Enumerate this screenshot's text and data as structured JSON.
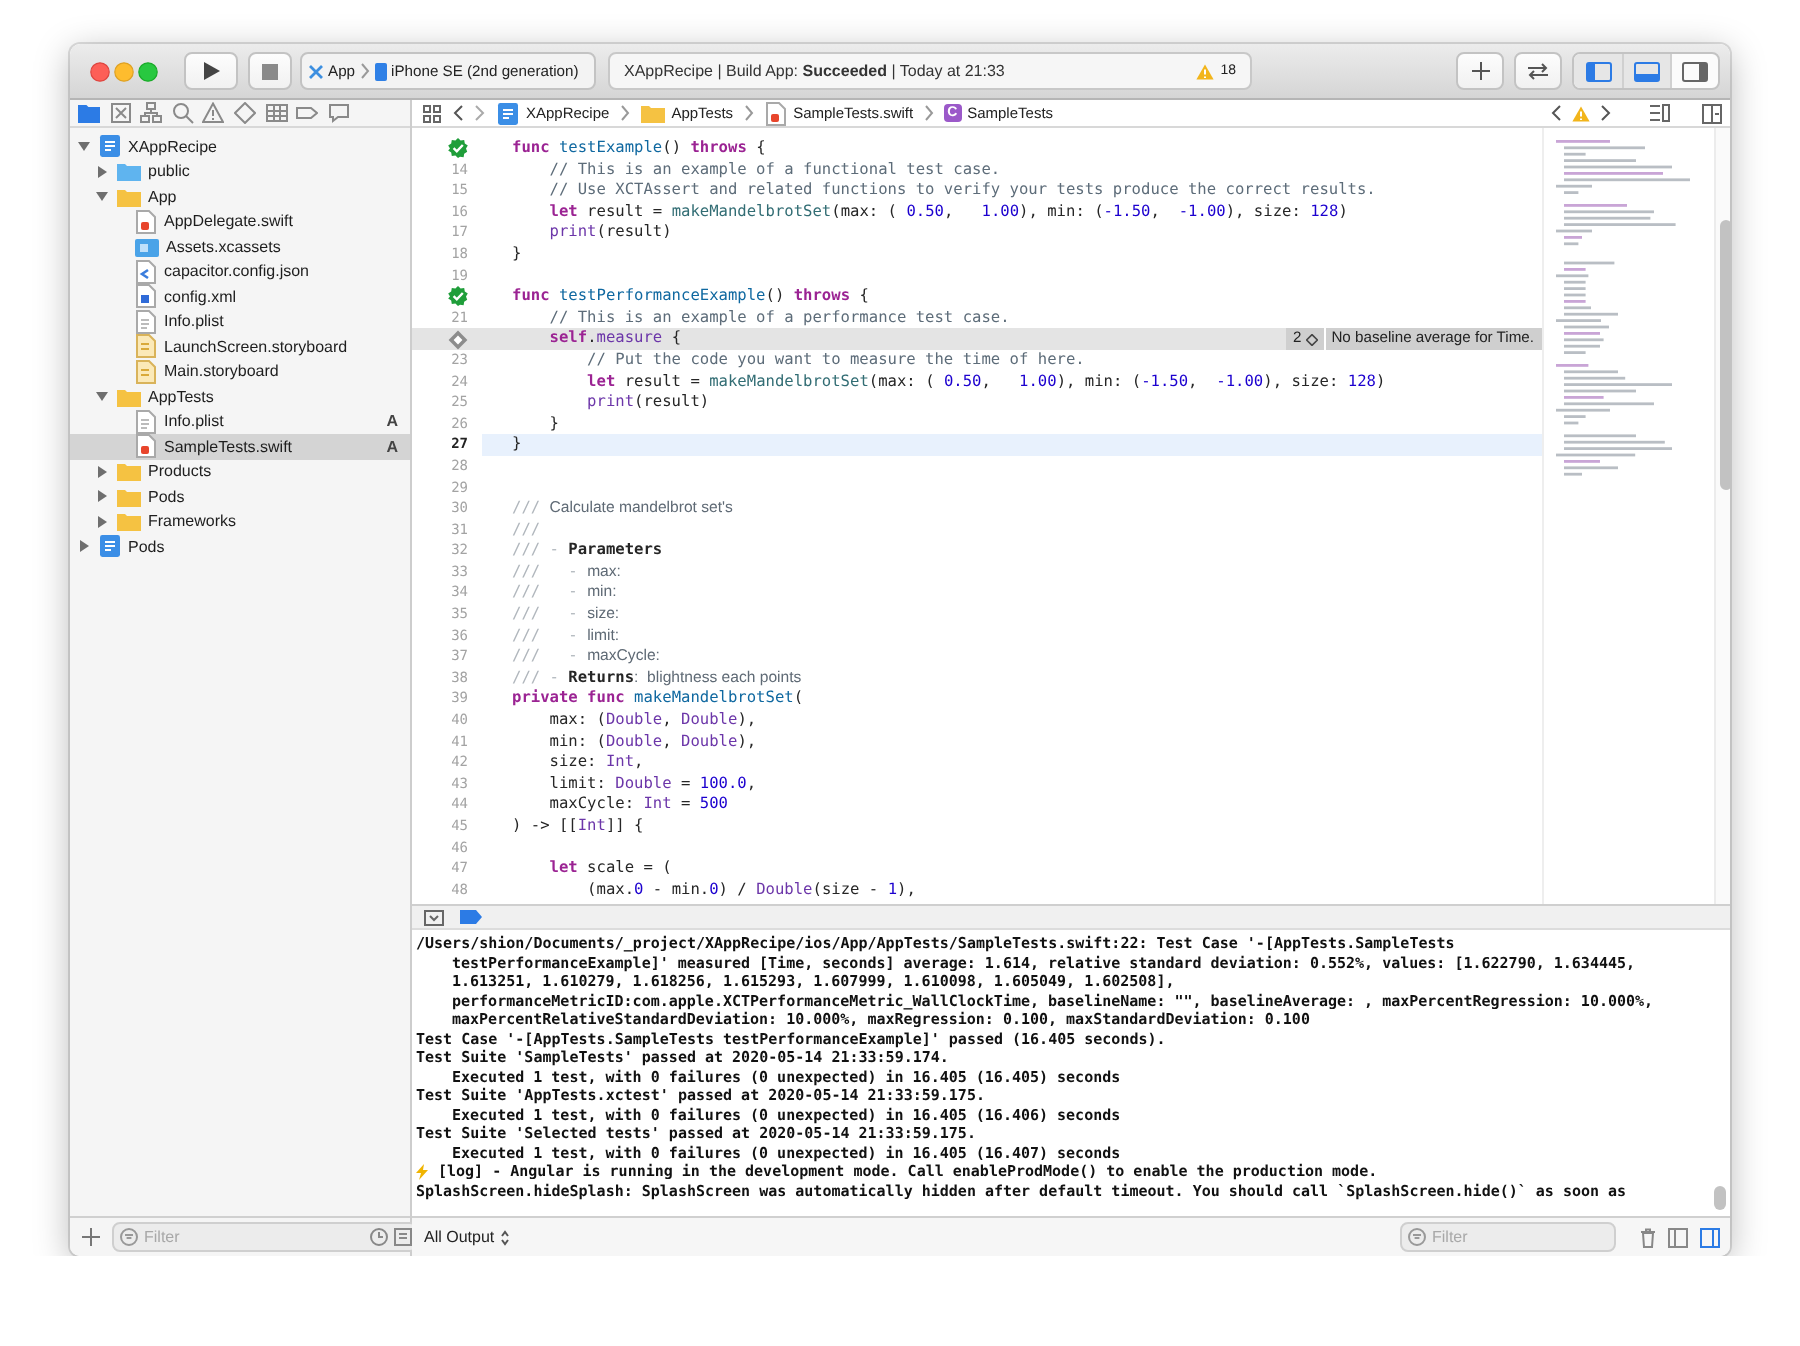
{
  "toolbar": {
    "scheme": {
      "target": "App",
      "device": "iPhone SE (2nd generation)"
    },
    "status": {
      "text": "XAppRecipe | Build App: **Succeeded** | Today at 21:33",
      "warnings": "18"
    },
    "panel_toggles": [
      {
        "kind": "navigator",
        "selected": true
      },
      {
        "kind": "debug",
        "selected": true
      },
      {
        "kind": "inspector",
        "selected": false
      }
    ]
  },
  "navigator": {
    "tabs": [
      {
        "kind": "project",
        "selected": true
      },
      {
        "kind": "source_control",
        "selected": false
      },
      {
        "kind": "symbols",
        "selected": false
      },
      {
        "kind": "find",
        "selected": false
      },
      {
        "kind": "issues",
        "selected": false
      },
      {
        "kind": "tests",
        "selected": false
      },
      {
        "kind": "debug",
        "selected": false
      },
      {
        "kind": "breakpoints",
        "selected": false
      },
      {
        "kind": "reports",
        "selected": false
      }
    ],
    "tree": [
      {
        "label": "XAppRecipe",
        "kind": "project",
        "expanded": true,
        "selected": false,
        "children": [
          {
            "label": "public",
            "kind": "folder_reference",
            "expanded": false,
            "selected": false
          },
          {
            "label": "App",
            "kind": "group",
            "expanded": true,
            "selected": false,
            "children": [
              {
                "label": "AppDelegate.swift",
                "kind": "swift",
                "selected": false
              },
              {
                "label": "Assets.xcassets",
                "kind": "assets",
                "selected": false
              },
              {
                "label": "capacitor.config.json",
                "kind": "json",
                "selected": false
              },
              {
                "label": "config.xml",
                "kind": "xml",
                "selected": false
              },
              {
                "label": "Info.plist",
                "kind": "plist",
                "selected": false
              },
              {
                "label": "LaunchScreen.storyboard",
                "kind": "storyboard",
                "selected": false
              },
              {
                "label": "Main.storyboard",
                "kind": "storyboard",
                "selected": false
              }
            ]
          },
          {
            "label": "AppTests",
            "kind": "group",
            "expanded": true,
            "selected": false,
            "children": [
              {
                "label": "Info.plist",
                "kind": "plist",
                "status": "A",
                "selected": false
              },
              {
                "label": "SampleTests.swift",
                "kind": "swift",
                "status": "A",
                "selected": true
              }
            ]
          },
          {
            "label": "Products",
            "kind": "group",
            "expanded": false,
            "selected": false
          },
          {
            "label": "Pods",
            "kind": "group",
            "expanded": false,
            "selected": false
          },
          {
            "label": "Frameworks",
            "kind": "group",
            "expanded": false,
            "selected": false
          }
        ]
      },
      {
        "label": "Pods",
        "kind": "project",
        "expanded": false,
        "selected": false
      }
    ],
    "filter": {
      "placeholder": "Filter"
    }
  },
  "jump_bar": {
    "crumbs": [
      {
        "kind": "project",
        "label": "XAppRecipe"
      },
      {
        "kind": "folder",
        "label": "AppTests"
      },
      {
        "kind": "swift",
        "label": "SampleTests.swift"
      },
      {
        "kind": "class",
        "badge": "C",
        "label": "SampleTests"
      }
    ]
  },
  "editor": {
    "lines": [
      {
        "kind": "test_passed",
        "current": false,
        "tokens": [
          {
            "kind": "kw",
            "text": "func"
          },
          {
            "kind": "decl",
            "text": " testExample"
          },
          {
            "kind": "plain",
            "text": "() "
          },
          {
            "kind": "kw",
            "text": "throws"
          },
          {
            "kind": "plain",
            "text": " {"
          }
        ]
      },
      {
        "kind": "code",
        "number": "14",
        "current": false,
        "tokens": [
          {
            "kind": "comment",
            "text": "    // This is an example of a functional test case."
          }
        ]
      },
      {
        "kind": "code",
        "number": "15",
        "current": false,
        "tokens": [
          {
            "kind": "comment",
            "text": "    // Use XCTAssert and related functions to verify your tests produce the correct results."
          }
        ]
      },
      {
        "kind": "code",
        "number": "16",
        "current": false,
        "tokens": [
          {
            "kind": "kw",
            "text": "    let"
          },
          {
            "kind": "plain",
            "text": " result = "
          },
          {
            "kind": "fn",
            "text": "makeMandelbrotSet"
          },
          {
            "kind": "plain",
            "text": "(max: ( "
          },
          {
            "kind": "num",
            "text": "0.50"
          },
          {
            "kind": "plain",
            "text": ",   "
          },
          {
            "kind": "num",
            "text": "1.00"
          },
          {
            "kind": "plain",
            "text": "), min: ("
          },
          {
            "kind": "num",
            "text": "-1.50"
          },
          {
            "kind": "plain",
            "text": ",  "
          },
          {
            "kind": "num",
            "text": "-1.00"
          },
          {
            "kind": "plain",
            "text": "), size: "
          },
          {
            "kind": "num",
            "text": "128"
          },
          {
            "kind": "plain",
            "text": ")"
          }
        ]
      },
      {
        "kind": "code",
        "number": "17",
        "current": false,
        "tokens": [
          {
            "kind": "sys",
            "text": "    print"
          },
          {
            "kind": "plain",
            "text": "(result)"
          }
        ]
      },
      {
        "kind": "code",
        "number": "18",
        "current": false,
        "tokens": [
          {
            "kind": "plain",
            "text": "}"
          }
        ]
      },
      {
        "kind": "code",
        "number": "19",
        "current": false
      },
      {
        "kind": "test_passed",
        "current": false,
        "tokens": [
          {
            "kind": "kw",
            "text": "func"
          },
          {
            "kind": "decl",
            "text": " testPerformanceExample"
          },
          {
            "kind": "plain",
            "text": "() "
          },
          {
            "kind": "kw",
            "text": "throws"
          },
          {
            "kind": "plain",
            "text": " {"
          }
        ]
      },
      {
        "kind": "code",
        "number": "21",
        "current": false,
        "tokens": [
          {
            "kind": "comment",
            "text": "    // This is an example of a performance test case."
          }
        ]
      },
      {
        "kind": "test_diamond",
        "current": false,
        "annotation": {
          "count": "2",
          "text": "No baseline average for Time."
        },
        "tokens": [
          {
            "kind": "kw",
            "text": "    self"
          },
          {
            "kind": "plain",
            "text": "."
          },
          {
            "kind": "sys",
            "text": "measure"
          },
          {
            "kind": "plain",
            "text": " {"
          }
        ]
      },
      {
        "kind": "code",
        "number": "23",
        "current": false,
        "tokens": [
          {
            "kind": "comment",
            "text": "        // Put the code you want to measure the time of here."
          }
        ]
      },
      {
        "kind": "code",
        "number": "24",
        "current": false,
        "tokens": [
          {
            "kind": "kw",
            "text": "        let"
          },
          {
            "kind": "plain",
            "text": " result = "
          },
          {
            "kind": "fn",
            "text": "makeMandelbrotSet"
          },
          {
            "kind": "plain",
            "text": "(max: ( "
          },
          {
            "kind": "num",
            "text": "0.50"
          },
          {
            "kind": "plain",
            "text": ",   "
          },
          {
            "kind": "num",
            "text": "1.00"
          },
          {
            "kind": "plain",
            "text": "), min: ("
          },
          {
            "kind": "num",
            "text": "-1.50"
          },
          {
            "kind": "plain",
            "text": ",  "
          },
          {
            "kind": "num",
            "text": "-1.00"
          },
          {
            "kind": "plain",
            "text": "), size: "
          },
          {
            "kind": "num",
            "text": "128"
          },
          {
            "kind": "plain",
            "text": ")"
          }
        ]
      },
      {
        "kind": "code",
        "number": "25",
        "current": false,
        "tokens": [
          {
            "kind": "sys",
            "text": "        print"
          },
          {
            "kind": "plain",
            "text": "(result)"
          }
        ]
      },
      {
        "kind": "code",
        "number": "26",
        "current": false,
        "tokens": [
          {
            "kind": "plain",
            "text": "    }"
          }
        ]
      },
      {
        "kind": "code",
        "number": "27",
        "current": true,
        "tokens": [
          {
            "kind": "plain",
            "text": "}"
          }
        ]
      },
      {
        "kind": "code",
        "number": "28",
        "current": false
      },
      {
        "kind": "code",
        "number": "29",
        "current": false
      },
      {
        "kind": "code",
        "number": "30",
        "current": false,
        "tokens": [
          {
            "kind": "docmark",
            "text": "/// "
          },
          {
            "kind": "doc",
            "text": "Calculate mandelbrot set's"
          }
        ]
      },
      {
        "kind": "code",
        "number": "31",
        "current": false,
        "tokens": [
          {
            "kind": "docmark",
            "text": "///"
          }
        ]
      },
      {
        "kind": "code",
        "number": "32",
        "current": false,
        "tokens": [
          {
            "kind": "docmark",
            "text": "/// - "
          },
          {
            "kind": "docbold",
            "text": "Parameters"
          }
        ]
      },
      {
        "kind": "code",
        "number": "33",
        "current": false,
        "tokens": [
          {
            "kind": "docmark",
            "text": "///   - "
          },
          {
            "kind": "doc",
            "text": "max:"
          }
        ]
      },
      {
        "kind": "code",
        "number": "34",
        "current": false,
        "tokens": [
          {
            "kind": "docmark",
            "text": "///   - "
          },
          {
            "kind": "doc",
            "text": "min:"
          }
        ]
      },
      {
        "kind": "code",
        "number": "35",
        "current": false,
        "tokens": [
          {
            "kind": "docmark",
            "text": "///   - "
          },
          {
            "kind": "doc",
            "text": "size:"
          }
        ]
      },
      {
        "kind": "code",
        "number": "36",
        "current": false,
        "tokens": [
          {
            "kind": "docmark",
            "text": "///   - "
          },
          {
            "kind": "doc",
            "text": "limit:"
          }
        ]
      },
      {
        "kind": "code",
        "number": "37",
        "current": false,
        "tokens": [
          {
            "kind": "docmark",
            "text": "///   - "
          },
          {
            "kind": "doc",
            "text": "maxCycle:"
          }
        ]
      },
      {
        "kind": "code",
        "number": "38",
        "current": false,
        "tokens": [
          {
            "kind": "docmark",
            "text": "/// - "
          },
          {
            "kind": "docbold",
            "text": "Returns"
          },
          {
            "kind": "doc",
            "text": ":  blightness each points"
          }
        ]
      },
      {
        "kind": "code",
        "number": "39",
        "current": false,
        "tokens": [
          {
            "kind": "kw",
            "text": "private func"
          },
          {
            "kind": "decl",
            "text": " makeMandelbrotSet"
          },
          {
            "kind": "plain",
            "text": "("
          }
        ]
      },
      {
        "kind": "code",
        "number": "40",
        "current": false,
        "tokens": [
          {
            "kind": "plain",
            "text": "    max: ("
          },
          {
            "kind": "type",
            "text": "Double"
          },
          {
            "kind": "plain",
            "text": ", "
          },
          {
            "kind": "type",
            "text": "Double"
          },
          {
            "kind": "plain",
            "text": "),"
          }
        ]
      },
      {
        "kind": "code",
        "number": "41",
        "current": false,
        "tokens": [
          {
            "kind": "plain",
            "text": "    min: ("
          },
          {
            "kind": "type",
            "text": "Double"
          },
          {
            "kind": "plain",
            "text": ", "
          },
          {
            "kind": "type",
            "text": "Double"
          },
          {
            "kind": "plain",
            "text": "),"
          }
        ]
      },
      {
        "kind": "code",
        "number": "42",
        "current": false,
        "tokens": [
          {
            "kind": "plain",
            "text": "    size: "
          },
          {
            "kind": "type",
            "text": "Int"
          },
          {
            "kind": "plain",
            "text": ","
          }
        ]
      },
      {
        "kind": "code",
        "number": "43",
        "current": false,
        "tokens": [
          {
            "kind": "plain",
            "text": "    limit: "
          },
          {
            "kind": "type",
            "text": "Double"
          },
          {
            "kind": "plain",
            "text": " = "
          },
          {
            "kind": "num",
            "text": "100.0"
          },
          {
            "kind": "plain",
            "text": ","
          }
        ]
      },
      {
        "kind": "code",
        "number": "44",
        "current": false,
        "tokens": [
          {
            "kind": "plain",
            "text": "    maxCycle: "
          },
          {
            "kind": "type",
            "text": "Int"
          },
          {
            "kind": "plain",
            "text": " = "
          },
          {
            "kind": "num",
            "text": "500"
          }
        ]
      },
      {
        "kind": "code",
        "number": "45",
        "current": false,
        "tokens": [
          {
            "kind": "plain",
            "text": ") -> [["
          },
          {
            "kind": "type",
            "text": "Int"
          },
          {
            "kind": "plain",
            "text": "]] {"
          }
        ]
      },
      {
        "kind": "code",
        "number": "46",
        "current": false
      },
      {
        "kind": "code",
        "number": "47",
        "current": false,
        "tokens": [
          {
            "kind": "kw",
            "text": "    let"
          },
          {
            "kind": "plain",
            "text": " scale = ("
          }
        ]
      },
      {
        "kind": "code",
        "number": "48",
        "current": false,
        "tokens": [
          {
            "kind": "plain",
            "text": "        (max."
          },
          {
            "kind": "num",
            "text": "0"
          },
          {
            "kind": "plain",
            "text": " - min."
          },
          {
            "kind": "num",
            "text": "0"
          },
          {
            "kind": "plain",
            "text": ") / "
          },
          {
            "kind": "type",
            "text": "Double"
          },
          {
            "kind": "plain",
            "text": "(size - "
          },
          {
            "kind": "num",
            "text": "1"
          },
          {
            "kind": "plain",
            "text": "),"
          }
        ]
      }
    ]
  },
  "console": {
    "lines": [
      {
        "kind": "plain",
        "wrapped": false,
        "text": "/Users/shion/Documents/_project/XAppRecipe/ios/App/AppTests/SampleTests.swift:22: Test Case '-[AppTests.SampleTests"
      },
      {
        "kind": "plain",
        "wrapped": true,
        "text": "testPerformanceExample]' measured [Time, seconds] average: 1.614, relative standard deviation: 0.552%, values: [1.622790, 1.634445,"
      },
      {
        "kind": "plain",
        "wrapped": true,
        "text": "1.613251, 1.610279, 1.618256, 1.615293, 1.607999, 1.610098, 1.605049, 1.602508],"
      },
      {
        "kind": "plain",
        "wrapped": true,
        "text": "performanceMetricID:com.apple.XCTPerformanceMetric_WallClockTime, baselineName: \"\", baselineAverage: , maxPercentRegression: 10.000%,"
      },
      {
        "kind": "plain",
        "wrapped": true,
        "text": "maxPercentRelativeStandardDeviation: 10.000%, maxRegression: 0.100, maxStandardDeviation: 0.100"
      },
      {
        "kind": "plain",
        "wrapped": false,
        "text": "Test Case '-[AppTests.SampleTests testPerformanceExample]' passed (16.405 seconds)."
      },
      {
        "kind": "plain",
        "wrapped": false,
        "text": "Test Suite 'SampleTests' passed at 2020-05-14 21:33:59.174."
      },
      {
        "kind": "plain",
        "wrapped": true,
        "text": "Executed 1 test, with 0 failures (0 unexpected) in 16.405 (16.405) seconds"
      },
      {
        "kind": "plain",
        "wrapped": false,
        "text": "Test Suite 'AppTests.xctest' passed at 2020-05-14 21:33:59.175."
      },
      {
        "kind": "plain",
        "wrapped": true,
        "text": "Executed 1 test, with 0 failures (0 unexpected) in 16.405 (16.406) seconds"
      },
      {
        "kind": "plain",
        "wrapped": false,
        "text": "Test Suite 'Selected tests' passed at 2020-05-14 21:33:59.175."
      },
      {
        "kind": "plain",
        "wrapped": true,
        "text": "Executed 1 test, with 0 failures (0 unexpected) in 16.405 (16.407) seconds"
      },
      {
        "kind": "log",
        "wrapped": false,
        "text": "[log] - Angular is running in the development mode. Call enableProdMode() to enable the production mode."
      },
      {
        "kind": "plain",
        "wrapped": false,
        "text": "SplashScreen.hideSplash: SplashScreen was automatically hidden after default timeout. You should call `SplashScreen.hide()` as soon as"
      }
    ],
    "output_menu": "All Output",
    "filter": {
      "placeholder": "Filter"
    }
  }
}
